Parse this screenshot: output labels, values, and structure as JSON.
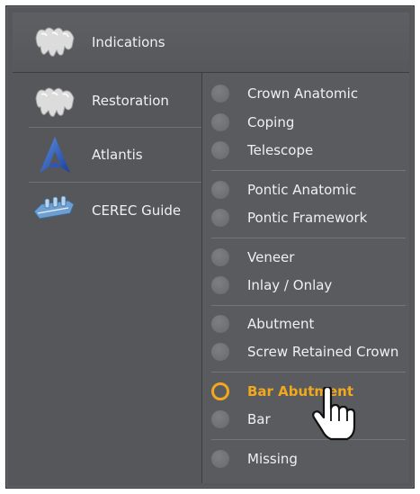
{
  "header": {
    "title": "Indications",
    "icon": "teeth-icon"
  },
  "sidebar": {
    "items": [
      {
        "label": "Restoration",
        "icon": "teeth-icon"
      },
      {
        "label": "Atlantis",
        "icon": "atlantis-logo"
      },
      {
        "label": "CEREC Guide",
        "icon": "cerec-guide-icon"
      }
    ]
  },
  "options": {
    "groups": [
      [
        "Crown Anatomic",
        "Coping",
        "Telescope"
      ],
      [
        "Pontic Anatomic",
        "Pontic Framework"
      ],
      [
        "Veneer",
        "Inlay / Onlay"
      ],
      [
        "Abutment",
        "Screw Retained Crown"
      ],
      [
        "Bar Abutment",
        "Bar"
      ],
      [
        "Missing"
      ]
    ],
    "selected": "Bar Abutment"
  },
  "colors": {
    "accent": "#f2a81d",
    "panel": "#55575a",
    "text": "#f0f0f0"
  }
}
